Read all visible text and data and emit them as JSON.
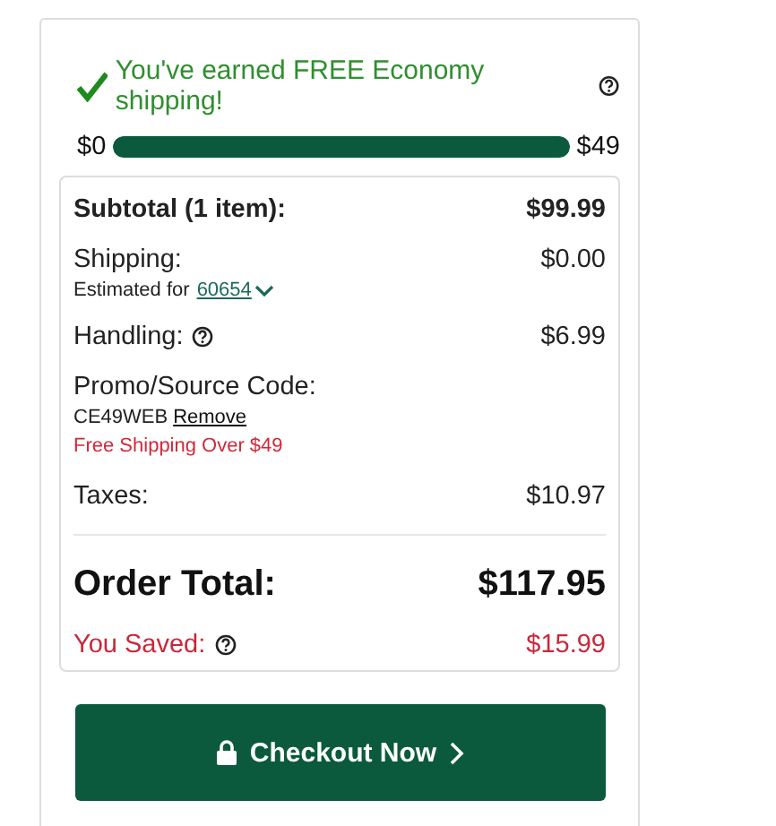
{
  "banner": {
    "text": "You've earned FREE Economy shipping!"
  },
  "progress": {
    "start": "$0",
    "end": "$49",
    "level": 1
  },
  "summary": [
    {
      "kind": "subtotal",
      "label": "Subtotal (1 item):",
      "value": "$99.99"
    },
    {
      "kind": "shipping",
      "label": "Shipping:",
      "value": "$0.00",
      "note": "Estimated for",
      "zip": "60654"
    },
    {
      "kind": "help",
      "label": "Handling:",
      "value": "$6.99"
    },
    {
      "kind": "promo",
      "label": "Promo/Source Code:",
      "code": "CE49WEB",
      "action": "Remove",
      "note": "Free Shipping Over $49"
    },
    {
      "kind": "plain",
      "label": "Taxes:",
      "value": "$10.97"
    },
    {
      "kind": "total",
      "label": "Order Total:",
      "value": "$117.95"
    },
    {
      "kind": "saved",
      "label": "You Saved:",
      "value": "$15.99"
    }
  ],
  "checkout": {
    "label": "Checkout Now"
  }
}
